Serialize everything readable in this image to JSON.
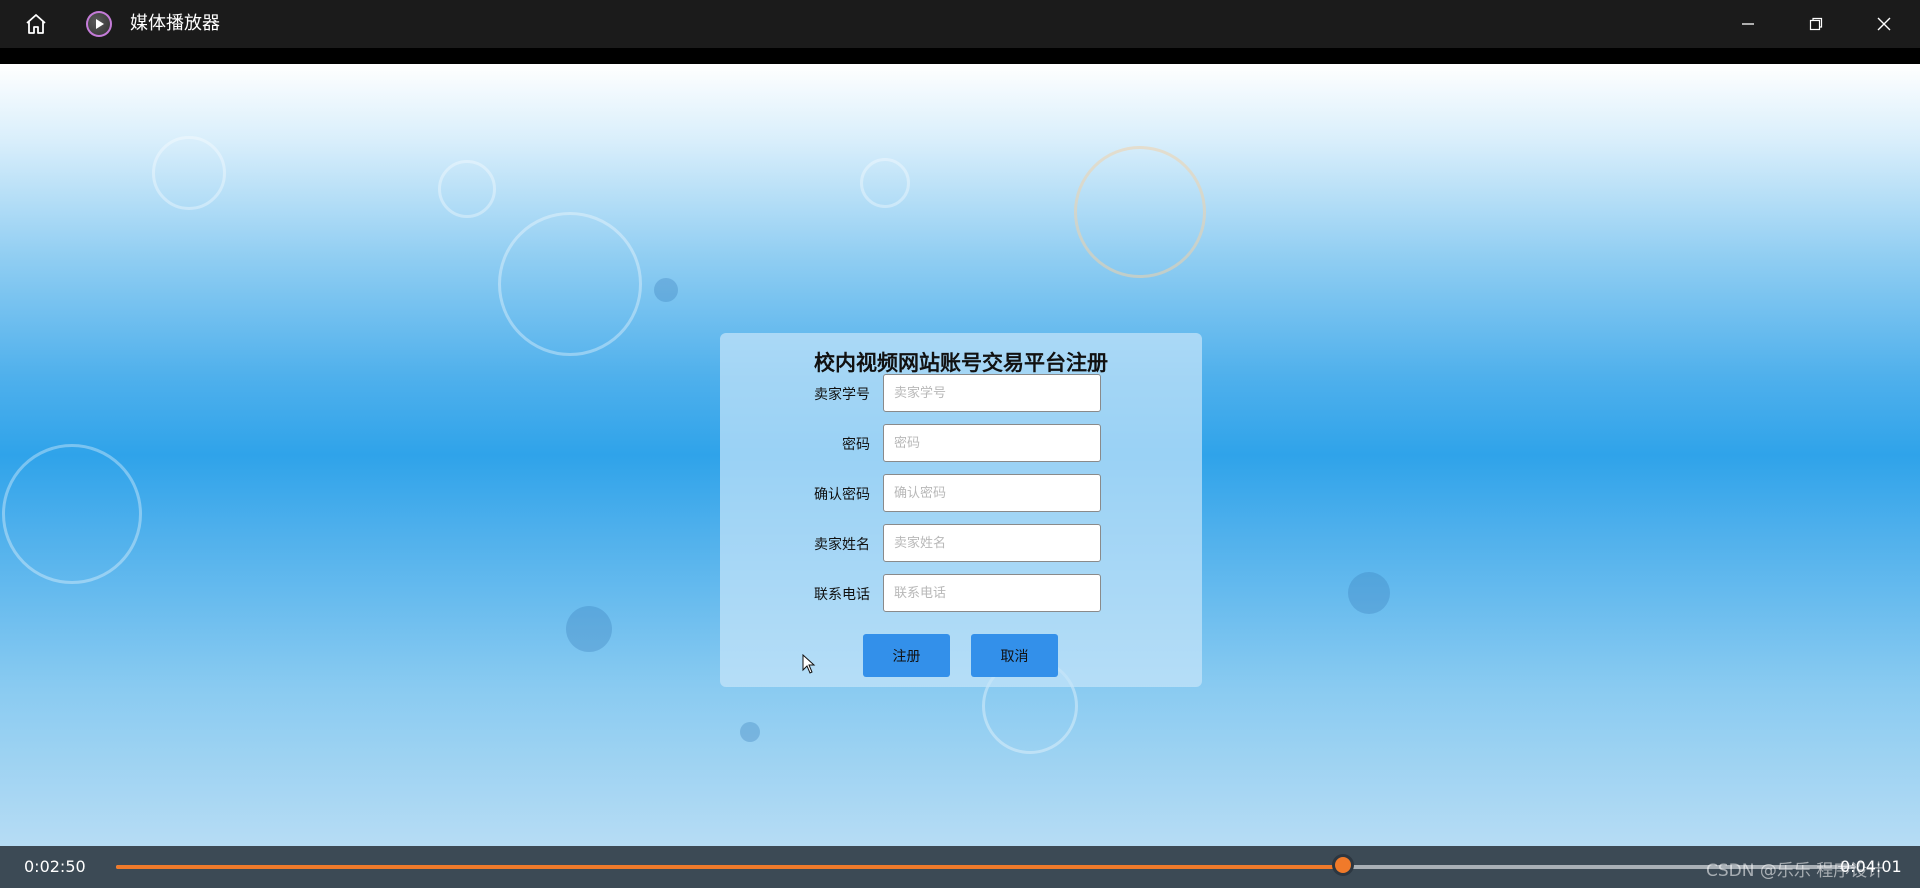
{
  "window": {
    "title": "媒体播放器",
    "icons": {
      "home": "home-icon",
      "app": "play-icon",
      "minimize": "minimize-icon",
      "maximize": "restore-icon",
      "close": "close-icon"
    }
  },
  "form": {
    "title": "校内视频网站账号交易平台注册",
    "fields": [
      {
        "label": "卖家学号",
        "placeholder": "卖家学号",
        "value": ""
      },
      {
        "label": "密码",
        "placeholder": "密码",
        "value": ""
      },
      {
        "label": "确认密码",
        "placeholder": "确认密码",
        "value": ""
      },
      {
        "label": "卖家姓名",
        "placeholder": "卖家姓名",
        "value": ""
      },
      {
        "label": "联系电话",
        "placeholder": "联系电话",
        "value": ""
      }
    ],
    "buttons": {
      "register": "注册",
      "cancel": "取消"
    },
    "colors": {
      "button": "#3390ea"
    }
  },
  "player": {
    "current_time": "0:02:50",
    "total_time": "0:04:01",
    "progress": 0.705,
    "colors": {
      "progress": "#f07a2a",
      "bar": "#3c4a55"
    }
  },
  "watermark": "CSDN @乐乐 程序设计"
}
